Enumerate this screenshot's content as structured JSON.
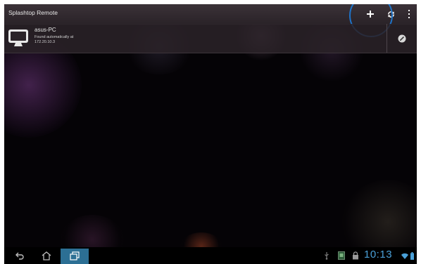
{
  "action_bar": {
    "title": "Splashtop Remote",
    "add_icon": "plus-icon",
    "refresh_icon": "refresh-icon",
    "overflow_icon": "overflow-menu-icon"
  },
  "computers": [
    {
      "name": "asus-PC",
      "status": "Found automatically at",
      "address": "172.20.10.3",
      "icon": "monitor-icon",
      "action_icon": "edit-icon"
    }
  ],
  "nav_bar": {
    "back_icon": "back-icon",
    "home_icon": "home-icon",
    "recents_icon": "recent-apps-icon"
  },
  "status_bar": {
    "time": "10:13",
    "icons": [
      "usb-icon",
      "media-icon",
      "lock-icon",
      "wifi-icon",
      "battery-icon"
    ]
  },
  "colors": {
    "background": "#050306",
    "action_bar": "#2f282d",
    "accent": "#4aa0d8",
    "highlight_ring": "#1e73c8"
  }
}
